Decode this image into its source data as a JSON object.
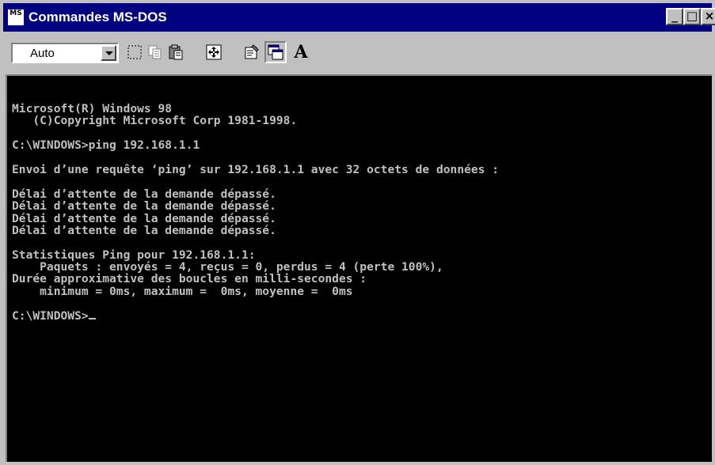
{
  "window": {
    "title": "Commandes MS-DOS",
    "icon": "ms-dos-icon",
    "icon_text": "MS",
    "controls": {
      "minimize": "_",
      "maximize": "□",
      "close": "×"
    }
  },
  "toolbar": {
    "font_size_value": "Auto",
    "tools": [
      {
        "name": "mark-icon"
      },
      {
        "name": "copy-icon"
      },
      {
        "name": "paste-icon"
      },
      {
        "name": "full-screen-icon"
      },
      {
        "name": "properties-icon"
      },
      {
        "name": "background-icon"
      },
      {
        "name": "font-icon",
        "label": "A"
      }
    ]
  },
  "console": {
    "lines": [
      "Microsoft(R) Windows 98",
      "   (C)Copyright Microsoft Corp 1981-1998.",
      "",
      "C:\\WINDOWS>ping 192.168.1.1",
      "",
      "Envoi d’une requête ‘ping’ sur 192.168.1.1 avec 32 octets de données :",
      "",
      "Délai d’attente de la demande dépassé.",
      "Délai d’attente de la demande dépassé.",
      "Délai d’attente de la demande dépassé.",
      "Délai d’attente de la demande dépassé.",
      "",
      "Statistiques Ping pour 192.168.1.1:",
      "    Paquets : envoyés = 4, reçus = 0, perdus = 4 (perte 100%),",
      "Durée approximative des boucles en milli-secondes :",
      "    minimum = 0ms, maximum =  0ms, moyenne =  0ms",
      "",
      "C:\\WINDOWS>"
    ]
  },
  "colors": {
    "title_bar": "#000080",
    "console_bg": "#000000",
    "console_text": "#c0c0c0",
    "chrome": "#c0c0c0"
  }
}
